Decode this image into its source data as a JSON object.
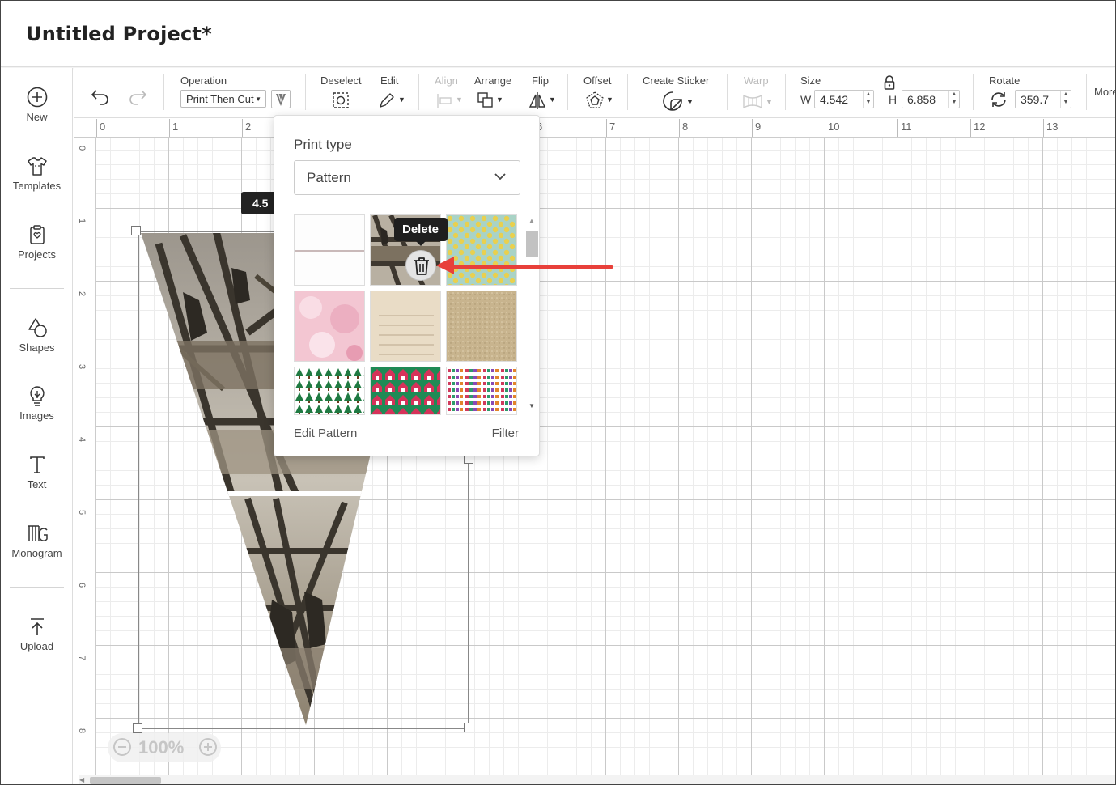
{
  "project": {
    "title": "Untitled Project*"
  },
  "sidebar": {
    "items": [
      {
        "label": "New",
        "icon": "plus-circle-icon"
      },
      {
        "label": "Templates",
        "icon": "tshirt-icon"
      },
      {
        "label": "Projects",
        "icon": "clipboard-icon"
      },
      {
        "label": "Shapes",
        "icon": "shapes-icon"
      },
      {
        "label": "Images",
        "icon": "lightbulb-icon"
      },
      {
        "label": "Text",
        "icon": "text-t-icon"
      },
      {
        "label": "Monogram",
        "icon": "monogram-icon"
      },
      {
        "label": "Upload",
        "icon": "upload-icon"
      }
    ]
  },
  "toolbar": {
    "operation_label": "Operation",
    "operation_value": "Print Then Cut",
    "deselect_label": "Deselect",
    "edit_label": "Edit",
    "align_label": "Align",
    "arrange_label": "Arrange",
    "flip_label": "Flip",
    "offset_label": "Offset",
    "create_sticker_label": "Create Sticker",
    "warp_label": "Warp",
    "size_label": "Size",
    "w_label": "W",
    "w_value": "4.542",
    "h_label": "H",
    "h_value": "6.858",
    "rotate_label": "Rotate",
    "rotate_value": "359.7",
    "more_label": "More"
  },
  "ruler": {
    "top": [
      "0",
      "1",
      "2",
      "3",
      "4",
      "5",
      "6",
      "7",
      "8",
      "9",
      "10",
      "11",
      "12",
      "13"
    ],
    "left": [
      "0",
      "1",
      "2",
      "3",
      "4",
      "5",
      "6",
      "7",
      "8"
    ]
  },
  "canvas": {
    "dimension_tag": "4.5",
    "zoom_level": "100%"
  },
  "popup": {
    "print_type_label": "Print type",
    "print_type_value": "Pattern",
    "edit_pattern_label": "Edit Pattern",
    "filter_label": "Filter",
    "tooltip": "Delete",
    "patterns": [
      "blank-white",
      "bridge-workers-photo",
      "yellow-dots",
      "pink-watercolor",
      "beige-lined-paper",
      "kraft-speckle",
      "green-trees",
      "holiday-houses",
      "merry-christmas-text"
    ]
  },
  "colors": {
    "annotation_arrow": "#e8403a",
    "tooltip_bg": "#1f1f1f"
  }
}
